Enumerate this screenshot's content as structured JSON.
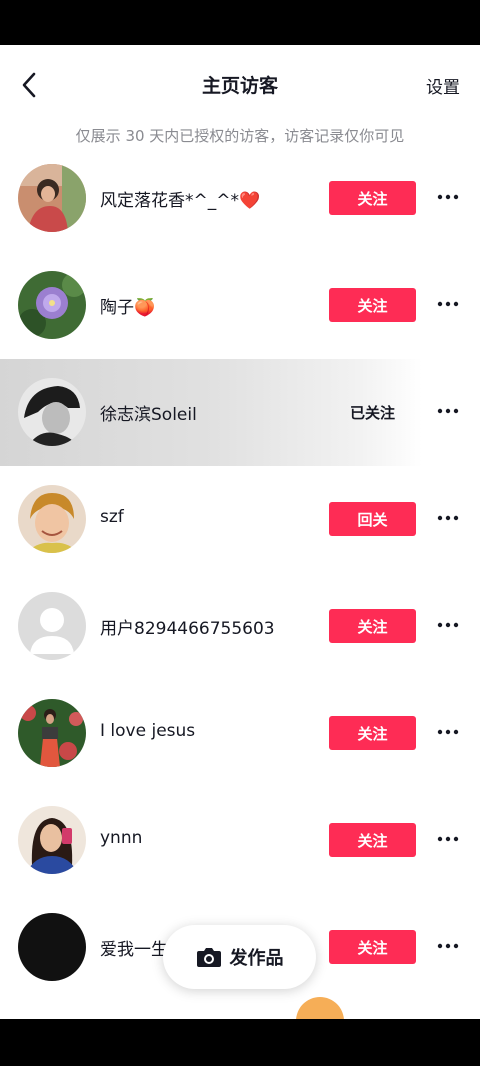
{
  "header": {
    "title": "主页访客",
    "settings_label": "设置",
    "notice": "仅展示 30 天内已授权的访客，访客记录仅你可见"
  },
  "visitors": [
    {
      "name": "风定落花香*^_^*❤️",
      "button": "关注"
    },
    {
      "name": "陶子🍑",
      "button": "关注"
    },
    {
      "name": "徐志滨Soleil",
      "button": "已关注"
    },
    {
      "name": "szf",
      "button": "回关"
    },
    {
      "name": "用户8294466755603",
      "button": "关注"
    },
    {
      "name": "I love jesus",
      "button": "关注"
    },
    {
      "name": "ynnn",
      "button": "关注"
    },
    {
      "name": "爱我一生",
      "button": "关注"
    }
  ],
  "fab": {
    "label": "发作品"
  },
  "colors": {
    "accent": "#fe2c55",
    "text": "#161823",
    "muted": "#8a8b91"
  }
}
